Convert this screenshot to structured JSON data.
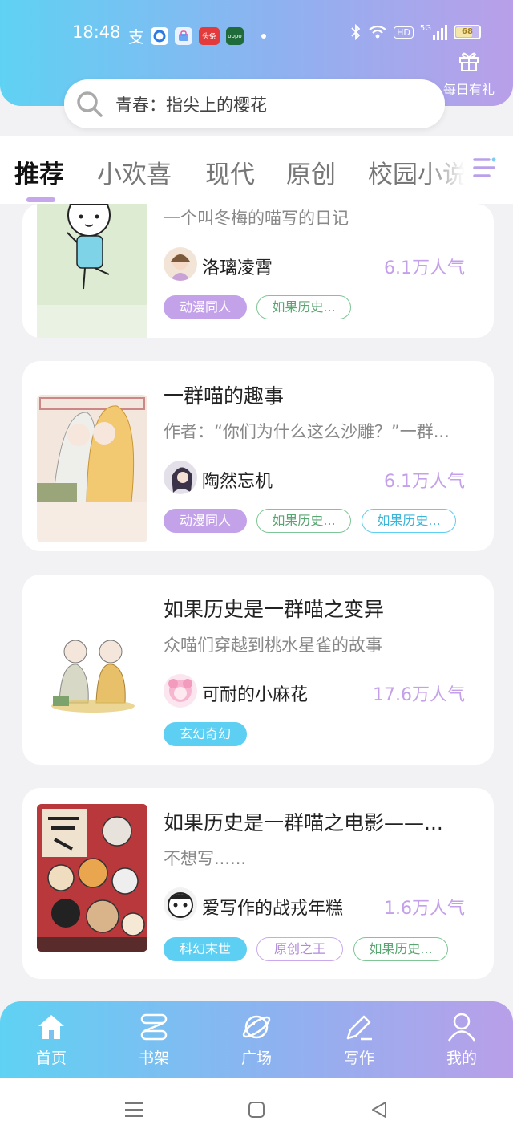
{
  "status_bar": {
    "time": "18:48",
    "icons": [
      "alipay-icon",
      "browser-icon",
      "store-icon",
      "toutiao-icon",
      "oppo-icon"
    ],
    "toutiao": "头条",
    "oppo": "oppo",
    "hd": "HD",
    "signal": "5G",
    "battery": "68"
  },
  "gift": {
    "label": "每日有礼"
  },
  "search": {
    "placeholder": "青春：指尖上的樱花"
  },
  "tabs": [
    "推荐",
    "小欢喜",
    "现代",
    "原创",
    "校园小说"
  ],
  "cards": [
    {
      "title": "",
      "desc": "一个叫冬梅的喵写的日记",
      "author": "洛璃凌霄",
      "popularity": "6.1万人气",
      "tags": [
        {
          "label": "动漫同人",
          "style": "fill-purple"
        },
        {
          "label": "如果历史...",
          "style": "out-green"
        }
      ]
    },
    {
      "title": "一群喵的趣事",
      "desc": "作者：“你们为什么这么沙雕？”一群...",
      "author": "陶然忘机",
      "popularity": "6.1万人气",
      "tags": [
        {
          "label": "动漫同人",
          "style": "fill-purple"
        },
        {
          "label": "如果历史...",
          "style": "out-green"
        },
        {
          "label": "如果历史...",
          "style": "out-blue"
        }
      ]
    },
    {
      "title": "如果历史是一群喵之变异",
      "desc": "众喵们穿越到桃水星雀的故事",
      "author": "可耐的小麻花",
      "popularity": "17.6万人气",
      "tags": [
        {
          "label": "玄幻奇幻",
          "style": "fill-blue"
        }
      ]
    },
    {
      "title": "如果历史是一群喵之电影——...",
      "desc": "不想写......",
      "author": "爱写作的战戎年糕",
      "popularity": "1.6万人气",
      "tags": [
        {
          "label": "科幻末世",
          "style": "fill-blue"
        },
        {
          "label": "原创之王",
          "style": "out-purple"
        },
        {
          "label": "如果历史...",
          "style": "out-green"
        }
      ]
    }
  ],
  "bottom_nav": [
    "首页",
    "书架",
    "广场",
    "写作",
    "我的"
  ],
  "colors": {
    "gradient_start": "#5fd2f3",
    "gradient_end": "#b99fe9",
    "popularity": "#c4a0ea"
  }
}
